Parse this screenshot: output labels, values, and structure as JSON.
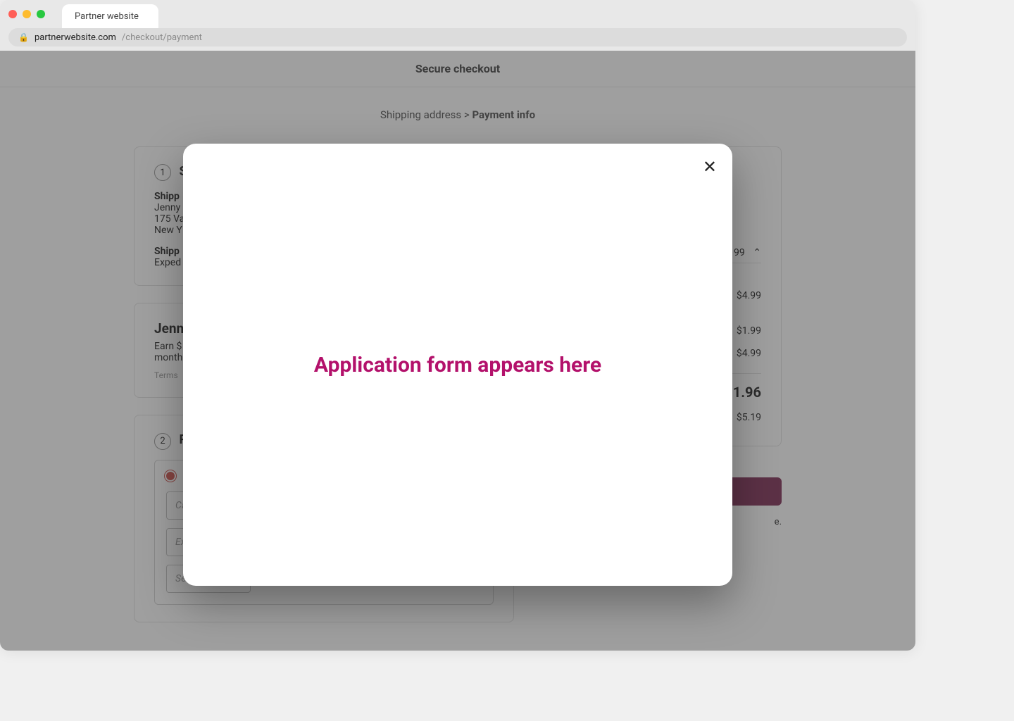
{
  "browser": {
    "tab_title": "Partner website",
    "url_host": "partnerwebsite.com",
    "url_path": "/checkout/payment"
  },
  "header": {
    "title": "Secure checkout"
  },
  "breadcrumb": {
    "prev": "Shipping address",
    "sep": ">",
    "current": "Payment info"
  },
  "shipping_card": {
    "step_num": "1",
    "step_title": "S",
    "address_label": "Shipp",
    "name": "Jenny",
    "street": "175 Va",
    "city": "New Y",
    "method_label": "Shipp",
    "method_value": "Exped"
  },
  "offer_card": {
    "name": "Jenn",
    "body_line1": "Earn $",
    "body_line2": "month",
    "terms": "Terms"
  },
  "payment_card": {
    "step_num": "2",
    "step_title": "P",
    "card_number_placeholder": "Ca",
    "exp_month_placeholder": "Expiration Month*",
    "exp_year_placeholder": "Expiration Year*",
    "cvv_placeholder": "Security Code*"
  },
  "summary": {
    "accordion_price": "99",
    "line1_price": "$4.99",
    "line2_price": "$1.99",
    "line3_price": "$4.99",
    "total_amount": "1.96",
    "monthly_amount": "$5.19",
    "finance_note": "e."
  },
  "cta": {
    "label": ""
  },
  "modal": {
    "message": "Application form appears here",
    "close_label": "✕"
  }
}
